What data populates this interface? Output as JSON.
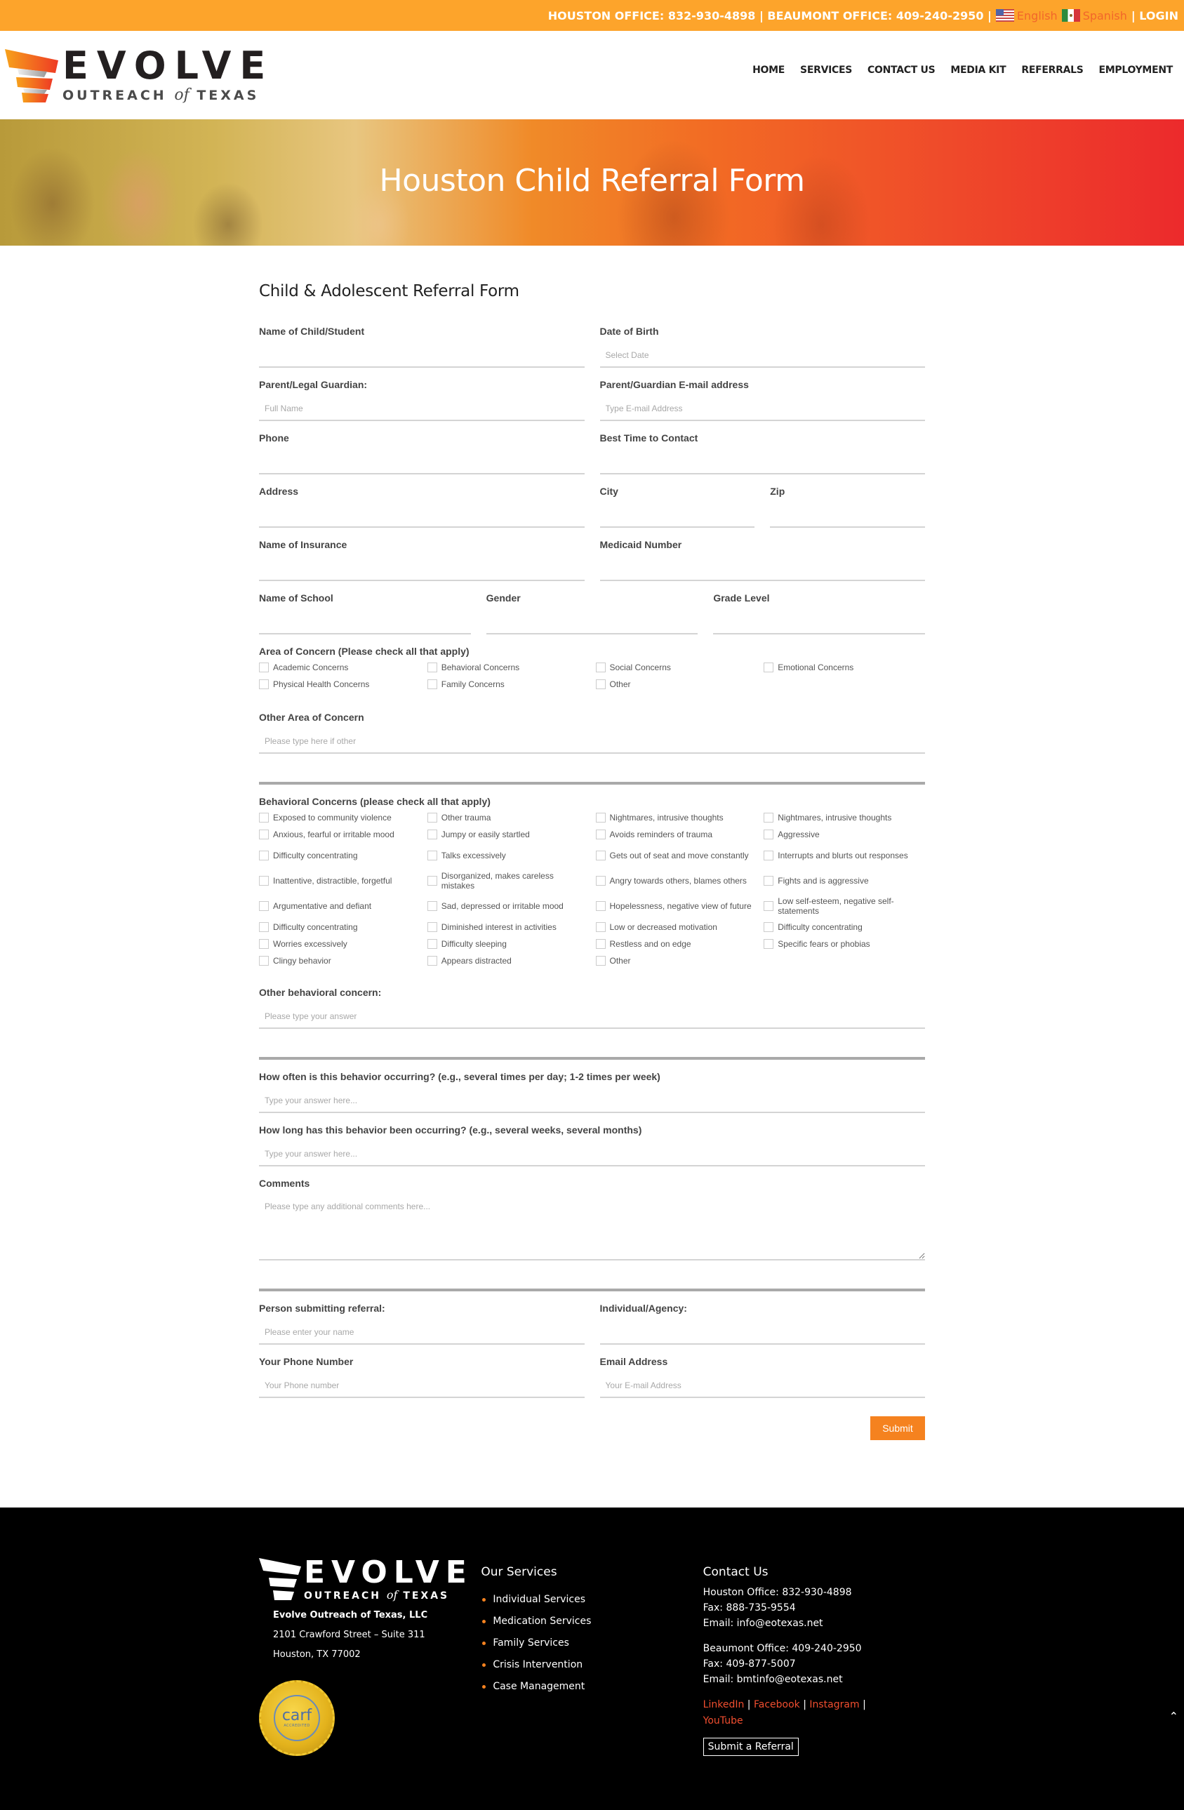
{
  "topbar": {
    "offices": "HOUSTON OFFICE: 832-930-4898 | BEAUMONT OFFICE: 409-240-2950 |",
    "lang_en": "English",
    "lang_es": "Spanish",
    "login": "| LOGIN"
  },
  "brand": {
    "name": "EVOLVE",
    "sub_pre": "OUTREACH",
    "sub_of": "of",
    "sub_post": "TEXAS"
  },
  "nav": [
    "HOME",
    "SERVICES",
    "CONTACT US",
    "MEDIA KIT",
    "REFERRALS",
    "EMPLOYMENT"
  ],
  "hero": {
    "title": "Houston Child Referral Form"
  },
  "form": {
    "title": "Child & Adolescent Referral Form",
    "child_name": {
      "label": "Name of Child/Student",
      "placeholder": ""
    },
    "dob": {
      "label": "Date of Birth",
      "placeholder": "Select Date"
    },
    "guardian": {
      "label": "Parent/Legal Guardian:",
      "placeholder": "Full Name"
    },
    "guardian_email": {
      "label": "Parent/Guardian E-mail address",
      "placeholder": "Type E-mail Address"
    },
    "phone": {
      "label": "Phone",
      "placeholder": ""
    },
    "best_time": {
      "label": "Best Time to Contact",
      "placeholder": ""
    },
    "address": {
      "label": "Address",
      "placeholder": ""
    },
    "city": {
      "label": "City",
      "placeholder": ""
    },
    "zip": {
      "label": "Zip",
      "placeholder": ""
    },
    "insurance": {
      "label": "Name of Insurance",
      "placeholder": ""
    },
    "medicaid": {
      "label": "Medicaid Number",
      "placeholder": ""
    },
    "school": {
      "label": "Name of School",
      "placeholder": ""
    },
    "gender": {
      "label": "Gender",
      "placeholder": ""
    },
    "grade": {
      "label": "Grade Level",
      "placeholder": ""
    },
    "area_concern": {
      "label": "Area of Concern (Please check all that apply)",
      "options": [
        "Academic Concerns",
        "Behavioral Concerns",
        "Social Concerns",
        "Emotional Concerns",
        "Physical Health Concerns",
        "Family Concerns",
        "Other"
      ]
    },
    "other_area": {
      "label": "Other Area of Concern",
      "placeholder": "Please type here if other"
    },
    "behavioral": {
      "label": "Behavioral Concerns (please check all that apply)",
      "options": [
        "Exposed to community violence",
        "Other trauma",
        "Nightmares, intrusive thoughts",
        "Nightmares, intrusive thoughts",
        "Anxious, fearful or irritable mood",
        "Jumpy or easily startled",
        "Avoids reminders of trauma",
        "Aggressive",
        "Difficulty concentrating",
        "Talks excessively",
        "Gets out of seat and move constantly",
        "Interrupts and blurts out responses",
        "Inattentive, distractible, forgetful",
        "Disorganized, makes careless mistakes",
        "Angry towards others, blames others",
        "Fights and is aggressive",
        "Argumentative and defiant",
        "Sad, depressed or irritable mood",
        "Hopelessness, negative view of future",
        "Low self-esteem, negative self-statements",
        "Difficulty concentrating",
        "Diminished interest in activities",
        "Low or decreased motivation",
        "Difficulty concentrating",
        "Worries excessively",
        "Difficulty sleeping",
        "Restless and on edge",
        "Specific fears or phobias",
        "Clingy behavior",
        "Appears distracted",
        "Other"
      ]
    },
    "other_behavioral": {
      "label": "Other behavioral concern:",
      "placeholder": "Please type your answer"
    },
    "how_often": {
      "label": "How often is this behavior occurring? (e.g., several times per day; 1-2 times per week)",
      "placeholder": "Type your answer here..."
    },
    "how_long": {
      "label": "How long has this behavior been occurring? (e.g., several weeks, several months)",
      "placeholder": "Type your answer here..."
    },
    "comments": {
      "label": "Comments",
      "placeholder": "Please type any additional comments here..."
    },
    "submitter": {
      "label": "Person submitting referral:",
      "placeholder": "Please enter your name"
    },
    "agency": {
      "label": "Individual/Agency:",
      "placeholder": ""
    },
    "your_phone": {
      "label": "Your Phone Number",
      "placeholder": "Your Phone number"
    },
    "your_email": {
      "label": "Email Address",
      "placeholder": "Your E-mail Address"
    },
    "submit_label": "Submit"
  },
  "footer": {
    "company": "Evolve Outreach of Texas, LLC",
    "address1": "2101 Crawford Street – Suite 311",
    "address2": "Houston, TX 77002",
    "carf": {
      "word": "carf",
      "accredited": "ACCREDITED"
    },
    "services_title": "Our Services",
    "services": [
      "Individual Services",
      "Medication Services",
      "Family Services",
      "Crisis Intervention",
      "Case Management"
    ],
    "contact_title": "Contact Us",
    "houston_office": "Houston Office: 832-930-4898",
    "houston_fax": "Fax: 888-735-9554",
    "houston_email": "Email: info@eotexas.net",
    "beaumont_office": "Beaumont Office: 409-240-2950",
    "beaumont_fax": "Fax: 409-877-5007",
    "beaumont_email": "Email: bmtinfo@eotexas.net",
    "social": [
      "LinkedIn",
      "Facebook",
      "Instagram",
      "YouTube"
    ],
    "referral_button": "Submit a Referral"
  },
  "colors": {
    "topbar": "#fda42b",
    "accent_orange": "#f5821f",
    "link_red": "#f04e2f",
    "footer_bg": "#000000"
  }
}
